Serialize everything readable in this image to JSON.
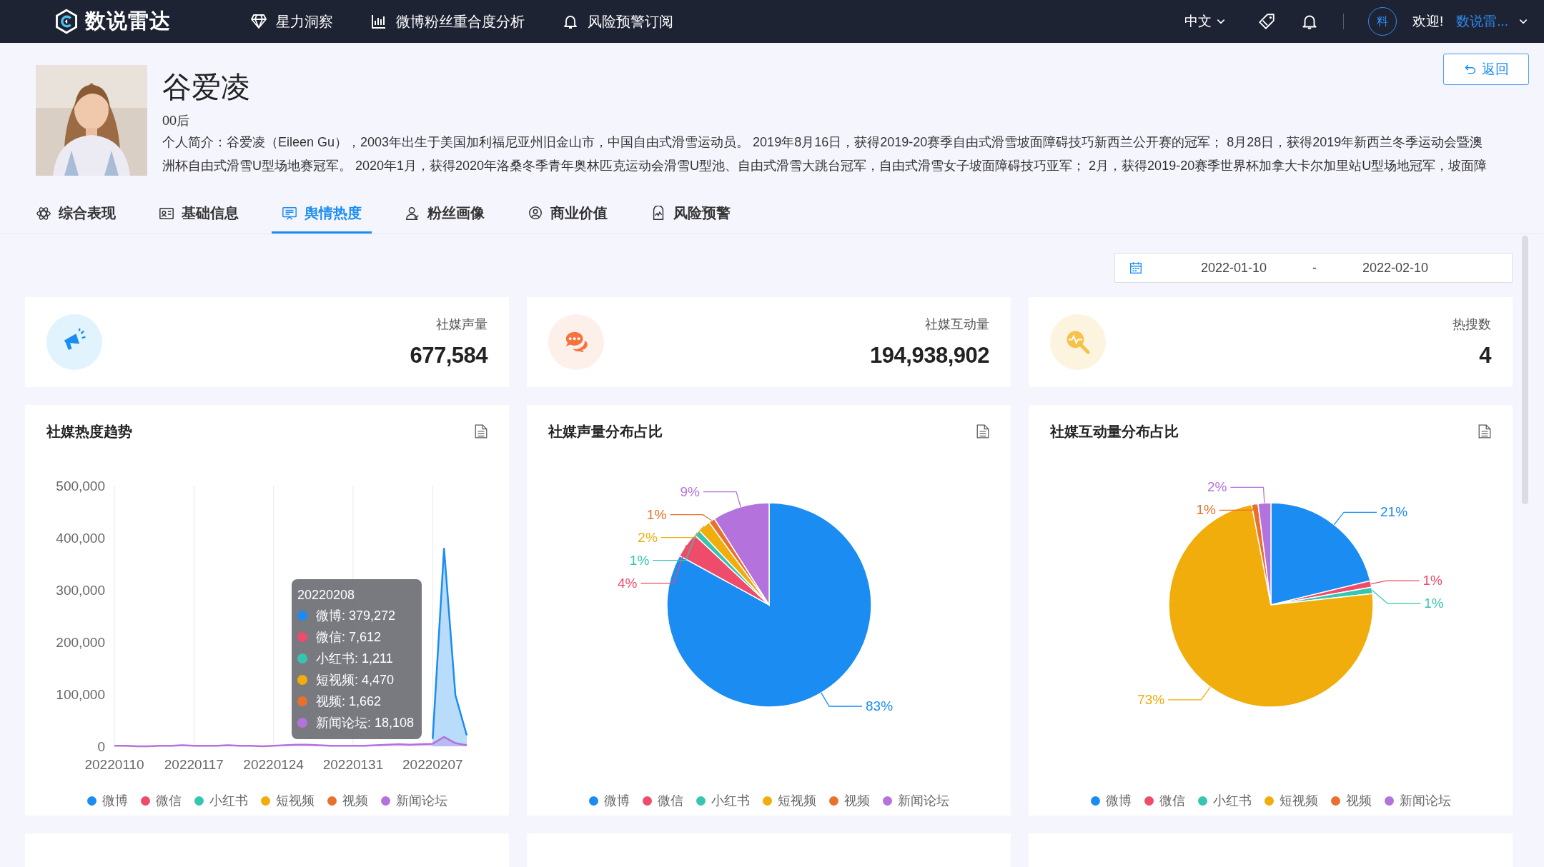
{
  "header": {
    "logo": "数说雷达",
    "nav": [
      {
        "label": "星力洞察"
      },
      {
        "label": "微博粉丝重合度分析"
      },
      {
        "label": "风险预警订阅"
      }
    ],
    "language": "中文",
    "avatar": "料",
    "welcome": "欢迎!",
    "user": "数说雷..."
  },
  "profile": {
    "name": "谷爱凌",
    "tag": "00后",
    "bio": "个人简介：谷爱凌（Eileen Gu），2003年出生于美国加利福尼亚州旧金山市，中国自由式滑雪运动员。 2019年8月16日，获得2019-20赛季自由式滑雪坡面障碍技巧新西兰公开赛的冠军； 8月28日，获得2019年新西兰冬季运动会暨澳洲杯自由式滑雪U型场地赛冠军。 2020年1月，获得2020年洛桑冬季青年奥林匹克运动会滑雪U型池、自由式滑雪大跳台冠军，自由式滑雪女子坡面障碍技巧亚军； 2月，获得2019-20赛季世界杯加拿大卡尔加里站U型场地冠军，坡面障",
    "back_button": "返回"
  },
  "tabs": [
    {
      "label": "综合表现",
      "selected": false
    },
    {
      "label": "基础信息",
      "selected": false
    },
    {
      "label": "舆情热度",
      "selected": true
    },
    {
      "label": "粉丝画像",
      "selected": false
    },
    {
      "label": "商业价值",
      "selected": false
    },
    {
      "label": "风险预警",
      "selected": false
    }
  ],
  "date_range": {
    "start": "2022-01-10",
    "separator": "-",
    "end": "2022-02-10"
  },
  "kpis": [
    {
      "label": "社媒声量",
      "value": "677,584"
    },
    {
      "label": "社媒互动量",
      "value": "194,938,902"
    },
    {
      "label": "热搜数",
      "value": "4"
    }
  ],
  "charts": [
    {
      "title": "社媒热度趋势",
      "chart_data": {
        "type": "area",
        "grid": true,
        "categories": [
          "20220110",
          null,
          null,
          null,
          null,
          null,
          null,
          "20220117",
          null,
          null,
          null,
          null,
          null,
          null,
          "20220124",
          null,
          null,
          null,
          null,
          null,
          null,
          "20220131",
          null,
          null,
          null,
          null,
          null,
          null,
          "20220207",
          null,
          null,
          null
        ],
        "series": [
          {
            "name": "微博",
            "color": "#1a8cf2",
            "values": [
              null,
              null,
              null,
              null,
              null,
              null,
              null,
              null,
              null,
              null,
              null,
              null,
              null,
              null,
              null,
              null,
              null,
              null,
              null,
              null,
              null,
              null,
              null,
              null,
              null,
              null,
              null,
              null,
              14000,
              379000,
              98000,
              21000
            ]
          },
          {
            "name": "微信",
            "color": "#ee4c6a",
            "values": [
              null,
              null,
              null,
              null,
              null,
              null,
              null,
              null,
              null,
              null,
              null,
              null,
              null,
              null,
              null,
              null,
              null,
              null,
              null,
              null,
              null,
              null,
              null,
              null,
              null,
              null,
              null,
              null,
              null,
              null,
              null,
              null
            ]
          },
          {
            "name": "小红书",
            "color": "#36c5b0",
            "values": [
              null,
              null,
              null,
              null,
              null,
              null,
              null,
              null,
              null,
              null,
              null,
              null,
              null,
              null,
              null,
              null,
              null,
              null,
              null,
              null,
              null,
              null,
              null,
              null,
              null,
              null,
              null,
              null,
              null,
              null,
              null,
              null
            ]
          },
          {
            "name": "短视频",
            "color": "#f0ad0b",
            "values": [
              null,
              null,
              null,
              null,
              null,
              null,
              null,
              null,
              null,
              null,
              null,
              null,
              null,
              null,
              null,
              null,
              null,
              null,
              null,
              null,
              null,
              null,
              null,
              null,
              null,
              null,
              null,
              null,
              null,
              null,
              null,
              null
            ]
          },
          {
            "name": "视频",
            "color": "#e8712e",
            "values": [
              null,
              null,
              null,
              null,
              null,
              null,
              null,
              null,
              null,
              null,
              null,
              null,
              null,
              null,
              null,
              null,
              null,
              null,
              null,
              null,
              null,
              null,
              null,
              null,
              null,
              null,
              null,
              null,
              null,
              null,
              null,
              null
            ]
          },
          {
            "name": "新闻论坛",
            "color": "#b472dd",
            "values": [
              1000,
              1000,
              0,
              0,
              1000,
              1000,
              2000,
              1000,
              1000,
              1000,
              2000,
              1000,
              1000,
              0,
              1000,
              2000,
              3000,
              3000,
              2000,
              1000,
              1000,
              1000,
              1000,
              2000,
              3000,
              4000,
              3000,
              4000,
              5000,
              18000,
              6000,
              2000
            ]
          }
        ],
        "ylim": [
          0,
          500000
        ],
        "yticks": [
          {
            "value": 0,
            "label": "0"
          },
          {
            "value": 100000,
            "label": "100,000"
          },
          {
            "value": 200000,
            "label": "200,000"
          },
          {
            "value": 300000,
            "label": "300,000"
          },
          {
            "value": 400000,
            "label": "400,000"
          },
          {
            "value": 500000,
            "label": "500,000"
          }
        ]
      },
      "tooltip": {
        "title": "20220208",
        "items": [
          {
            "text": "微博: 379,272",
            "color": "#1a8cf2"
          },
          {
            "text": "微信: 7,612",
            "color": "#ee4c6a"
          },
          {
            "text": "小红书: 1,211",
            "color": "#36c5b0"
          },
          {
            "text": "短视频: 4,470",
            "color": "#f0ad0b"
          },
          {
            "text": "视频: 1,662",
            "color": "#e8712e"
          },
          {
            "text": "新闻论坛: 18,108",
            "color": "#b472dd"
          }
        ]
      }
    },
    {
      "title": "社媒声量分布占比",
      "chart_data": {
        "type": "pie",
        "series": [
          {
            "values": [
              83,
              4,
              1,
              2,
              1,
              9
            ]
          }
        ],
        "value_labels": [
          "83%",
          "4%",
          "1%",
          "2%",
          "1%",
          "9%"
        ]
      },
      "legend": [
        {
          "label": "微博",
          "color": "#1a8cf2"
        },
        {
          "label": "微信",
          "color": "#ee4c6a"
        },
        {
          "label": "小红书",
          "color": "#36c5b0"
        },
        {
          "label": "短视频",
          "color": "#f0ad0b"
        },
        {
          "label": "视频",
          "color": "#e8712e"
        },
        {
          "label": "新闻论坛",
          "color": "#b472dd"
        }
      ]
    },
    {
      "title": "社媒互动量分布占比",
      "chart_data": {
        "type": "pie",
        "series": [
          {
            "values": [
              21,
              1,
              1,
              73,
              1,
              2
            ]
          }
        ],
        "value_labels": [
          "21%",
          "1%",
          "1%",
          "73%",
          "1%",
          "2%"
        ]
      },
      "legend": [
        {
          "label": "微博",
          "color": "#1a8cf2"
        },
        {
          "label": "微信",
          "color": "#ee4c6a"
        },
        {
          "label": "小红书",
          "color": "#36c5b0"
        },
        {
          "label": "短视频",
          "color": "#f0ad0b"
        },
        {
          "label": "视频",
          "color": "#e8712e"
        },
        {
          "label": "新闻论坛",
          "color": "#b472dd"
        }
      ]
    }
  ]
}
